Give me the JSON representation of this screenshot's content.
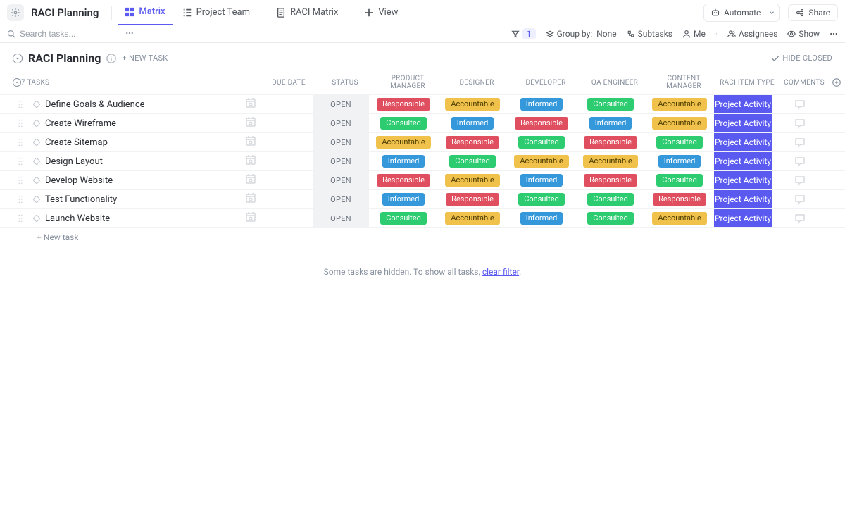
{
  "header": {
    "board_title": "RACI Planning",
    "tabs": [
      {
        "label": "Matrix",
        "icon": "matrix"
      },
      {
        "label": "Project Team",
        "icon": "list"
      },
      {
        "label": "RACI Matrix",
        "icon": "doc"
      }
    ],
    "view_label": "View",
    "automate_label": "Automate",
    "share_label": "Share"
  },
  "toolbar": {
    "search_placeholder": "Search tasks...",
    "filter_count": "1",
    "group_by_label": "Group by:",
    "group_by_value": "None",
    "subtasks_label": "Subtasks",
    "me_label": "Me",
    "assignees_label": "Assignees",
    "show_label": "Show"
  },
  "section": {
    "title": "RACI Planning",
    "new_task_label": "+ NEW TASK",
    "hide_closed_label": "HIDE CLOSED",
    "task_count_label": "7 TASKS"
  },
  "columns": {
    "due": "DUE DATE",
    "status": "STATUS",
    "roles": [
      "PRODUCT MANAGER",
      "DESIGNER",
      "DEVELOPER",
      "QA ENGINEER",
      "CONTENT MANAGER"
    ],
    "type": "RACI ITEM TYPE",
    "comments": "COMMENTS"
  },
  "status_label": "OPEN",
  "type_label": "Project Activity",
  "pill_labels": {
    "responsible": "Responsible",
    "accountable": "Accountable",
    "consulted": "Consulted",
    "informed": "Informed"
  },
  "tasks": [
    {
      "name": "Define Goals & Audience",
      "roles": [
        "responsible",
        "accountable",
        "informed",
        "consulted",
        "accountable"
      ]
    },
    {
      "name": "Create Wireframe",
      "roles": [
        "consulted",
        "informed",
        "responsible",
        "informed",
        "accountable"
      ]
    },
    {
      "name": "Create Sitemap",
      "roles": [
        "accountable",
        "responsible",
        "consulted",
        "responsible",
        "consulted"
      ]
    },
    {
      "name": "Design Layout",
      "roles": [
        "informed",
        "consulted",
        "accountable",
        "accountable",
        "informed"
      ]
    },
    {
      "name": "Develop Website",
      "roles": [
        "responsible",
        "accountable",
        "informed",
        "responsible",
        "consulted"
      ]
    },
    {
      "name": "Test Functionality",
      "roles": [
        "informed",
        "responsible",
        "consulted",
        "consulted",
        "responsible"
      ]
    },
    {
      "name": "Launch Website",
      "roles": [
        "consulted",
        "accountable",
        "informed",
        "consulted",
        "accountable"
      ]
    }
  ],
  "footer": {
    "new_task": "+ New task",
    "hidden_pre": "Some tasks are hidden. To show all tasks, ",
    "hidden_link": "clear filter",
    "hidden_post": "."
  }
}
